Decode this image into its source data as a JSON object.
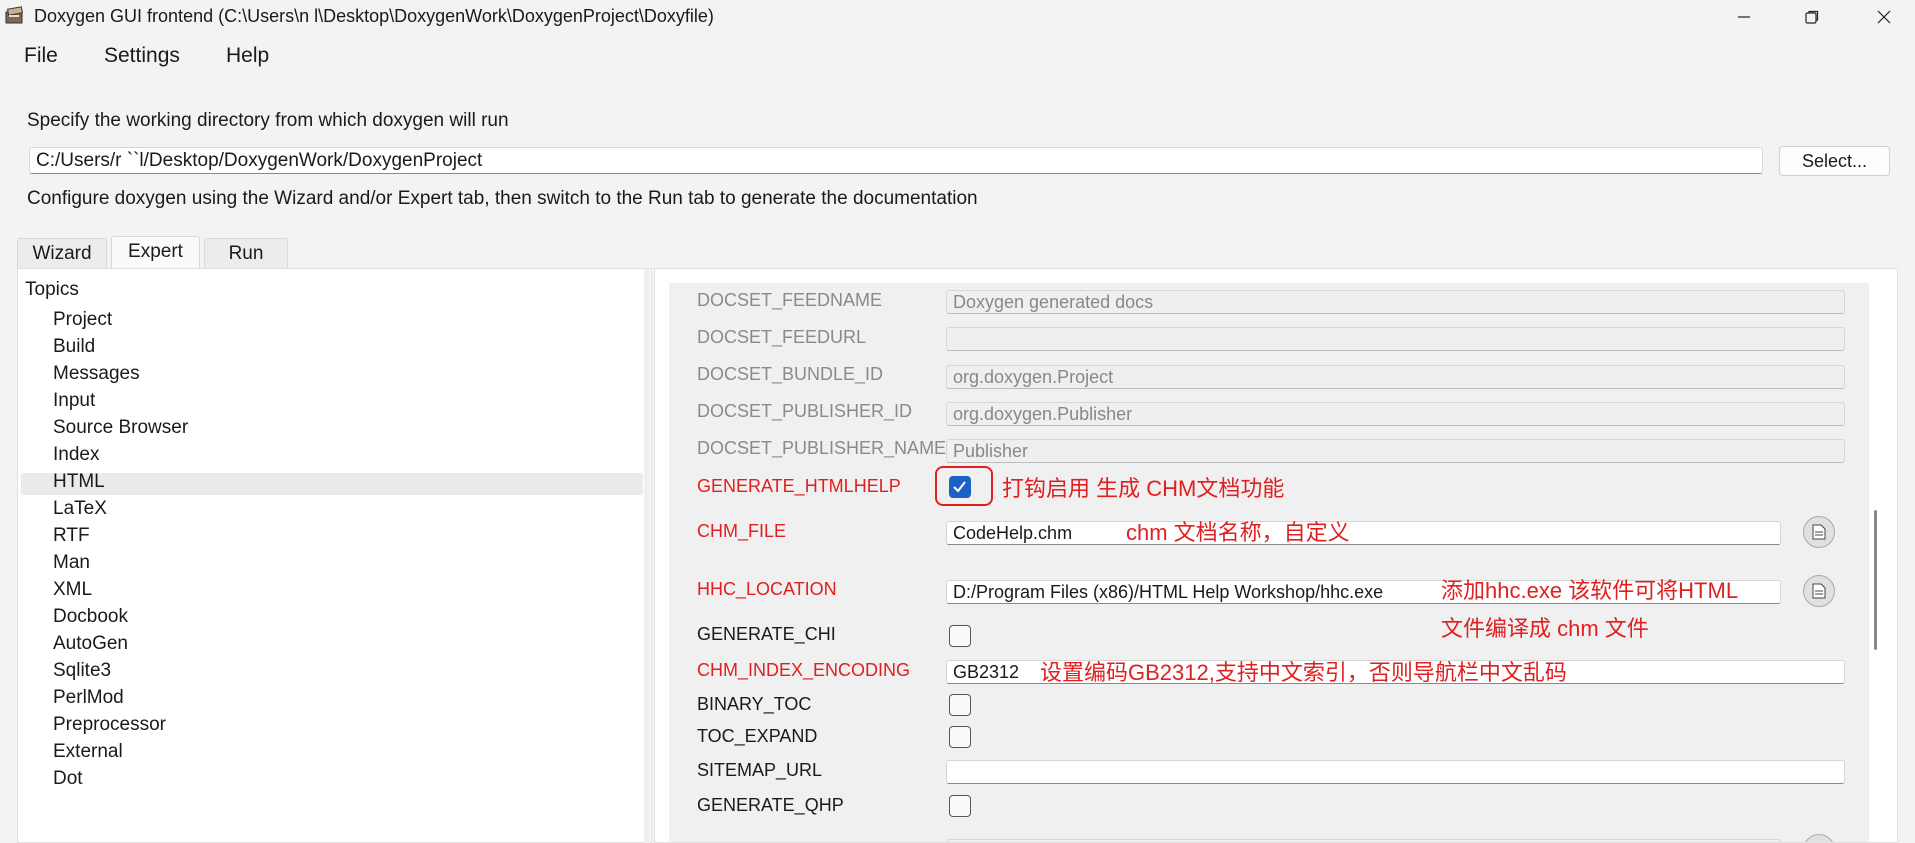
{
  "window": {
    "title": "Doxygen GUI frontend (C:\\Users\\n      l\\Desktop\\DoxygenWork\\DoxygenProject\\Doxyfile)",
    "controls": {
      "minimize": "—",
      "maximize": "❐",
      "close": "✕"
    }
  },
  "menu": [
    "File",
    "Settings",
    "Help"
  ],
  "working_dir": {
    "label": "Specify the working directory from which doxygen will run",
    "value": "C:/Users/r    ``l/Desktop/DoxygenWork/DoxygenProject",
    "select_label": "Select..."
  },
  "config_hint": "Configure doxygen using the Wizard and/or Expert tab, then switch to the Run tab to generate the documentation",
  "tabs": [
    "Wizard",
    "Expert",
    "Run"
  ],
  "active_tab": "Expert",
  "topics": {
    "heading": "Topics",
    "items": [
      "Project",
      "Build",
      "Messages",
      "Input",
      "Source Browser",
      "Index",
      "HTML",
      "LaTeX",
      "RTF",
      "Man",
      "XML",
      "Docbook",
      "AutoGen",
      "Sqlite3",
      "PerlMod",
      "Preprocessor",
      "External",
      "Dot"
    ],
    "selected": "HTML"
  },
  "options": {
    "docset_feedname": {
      "label": "DOCSET_FEEDNAME",
      "value": "Doxygen generated docs"
    },
    "docset_feedurl": {
      "label": "DOCSET_FEEDURL",
      "value": ""
    },
    "docset_bundle_id": {
      "label": "DOCSET_BUNDLE_ID",
      "value": "org.doxygen.Project"
    },
    "docset_publisher_id": {
      "label": "DOCSET_PUBLISHER_ID",
      "value": "org.doxygen.Publisher"
    },
    "docset_publisher_name": {
      "label": "DOCSET_PUBLISHER_NAME",
      "value": "Publisher"
    },
    "generate_htmlhelp": {
      "label": "GENERATE_HTMLHELP",
      "checked": true
    },
    "chm_file": {
      "label": "CHM_FILE",
      "value": "CodeHelp.chm"
    },
    "hhc_location": {
      "label": "HHC_LOCATION",
      "value": "D:/Program Files (x86)/HTML Help Workshop/hhc.exe"
    },
    "generate_chi": {
      "label": "GENERATE_CHI",
      "checked": false
    },
    "chm_index_encoding": {
      "label": "CHM_INDEX_ENCODING",
      "value": "GB2312"
    },
    "binary_toc": {
      "label": "BINARY_TOC",
      "checked": false
    },
    "toc_expand": {
      "label": "TOC_EXPAND",
      "checked": false
    },
    "sitemap_url": {
      "label": "SITEMAP_URL",
      "value": ""
    },
    "generate_qhp": {
      "label": "GENERATE_QHP",
      "checked": false
    }
  },
  "annotations": {
    "htmlhelp": "打钩启用 生成 CHM文档功能",
    "chm_file": "chm 文档名称，自定义",
    "hhc_line1": "添加hhc.exe 该软件可将HTML",
    "hhc_line2": "文件编译成 chm 文件",
    "encoding": "设置编码GB2312,支持中文索引，否则导航栏中文乱码"
  },
  "colors": {
    "annotation_red": "#e02020",
    "check_blue": "#1a63c6",
    "label_red": "#e02020"
  }
}
